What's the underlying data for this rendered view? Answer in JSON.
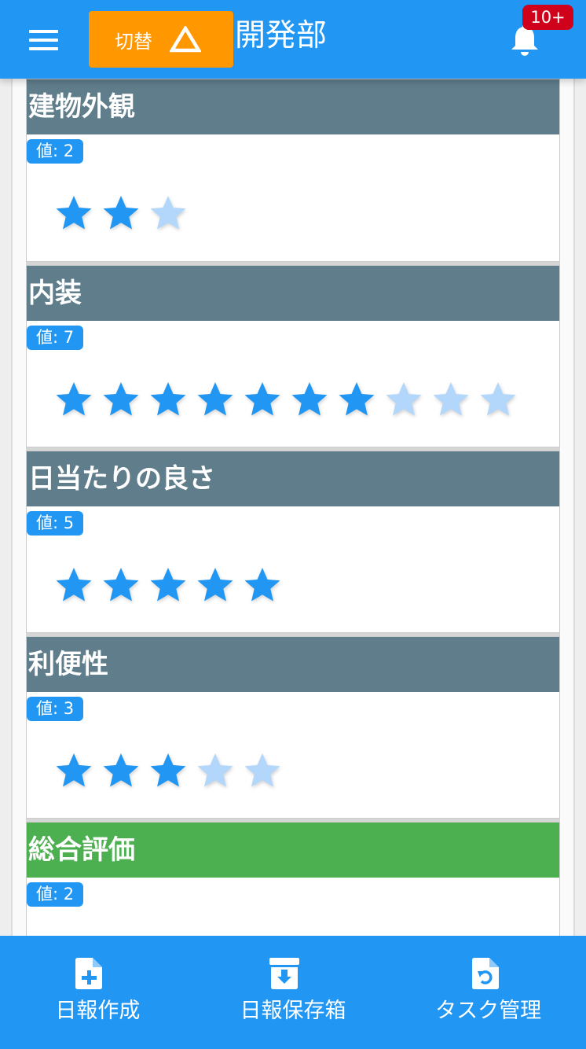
{
  "header": {
    "switch_label": "切替",
    "department": "開発部",
    "notification_count": "10+"
  },
  "sections": [
    {
      "title": "建物外観",
      "value_label": "値: 2",
      "rating": 2,
      "max": 3,
      "head_color": "#607d8b"
    },
    {
      "title": "内装",
      "value_label": "値: 7",
      "rating": 7,
      "max": 10,
      "head_color": "#607d8b"
    },
    {
      "title": "日当たりの良さ",
      "value_label": "値: 5",
      "rating": 5,
      "max": 5,
      "head_color": "#607d8b"
    },
    {
      "title": "利便性",
      "value_label": "値: 3",
      "rating": 3,
      "max": 5,
      "head_color": "#607d8b"
    },
    {
      "title": "総合評価",
      "value_label": "値: 2",
      "head_color": "#4caf50"
    }
  ],
  "bottom_nav": [
    {
      "label": "日報作成",
      "icon": "file-plus-icon"
    },
    {
      "label": "日報保存箱",
      "icon": "archive-box-icon"
    },
    {
      "label": "タスク管理",
      "icon": "file-refresh-icon"
    }
  ],
  "colors": {
    "primary": "#2196f3",
    "accent": "#ff9800",
    "badge": "#d0021b",
    "star_filled": "#2196f3",
    "star_empty": "#b3d7fa"
  }
}
